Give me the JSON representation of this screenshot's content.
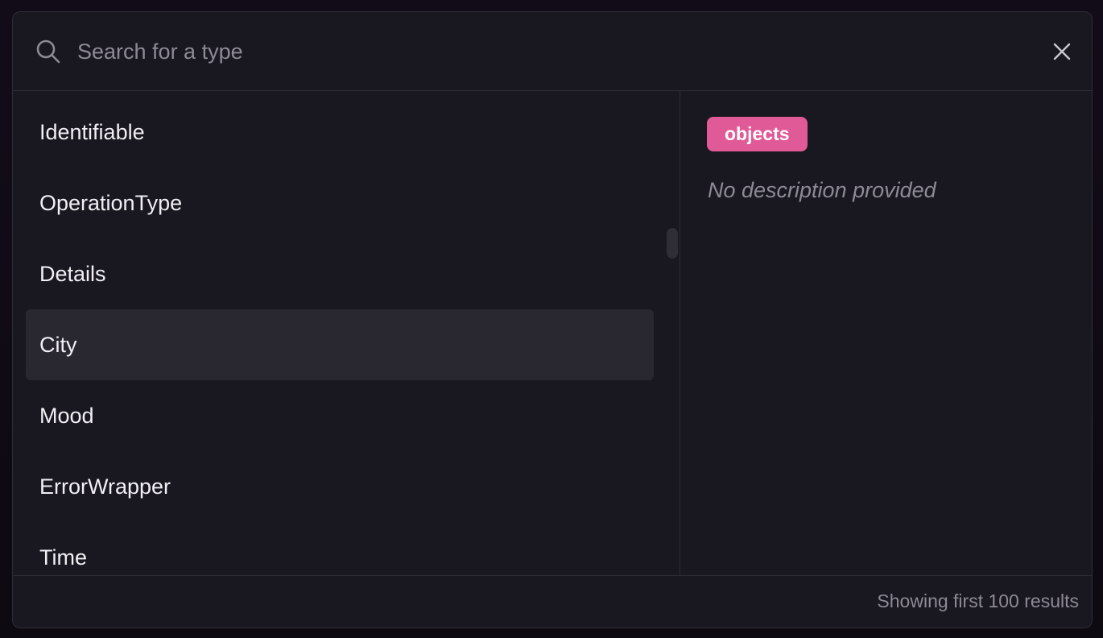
{
  "search": {
    "placeholder": "Search for a type",
    "value": ""
  },
  "list": {
    "items": [
      {
        "label": "Identifiable"
      },
      {
        "label": "OperationType"
      },
      {
        "label": "Details"
      },
      {
        "label": "City",
        "selected": true
      },
      {
        "label": "Mood"
      },
      {
        "label": "ErrorWrapper"
      },
      {
        "label": "Time"
      }
    ]
  },
  "detail": {
    "badge": "objects",
    "description": "No description provided"
  },
  "footer": {
    "results_text": "Showing first 100 results"
  },
  "icons": {
    "search": "search-icon",
    "close": "close-icon"
  },
  "colors": {
    "accent_badge": "#e05a98",
    "background": "#19171f",
    "selected_row": "#29272f"
  }
}
